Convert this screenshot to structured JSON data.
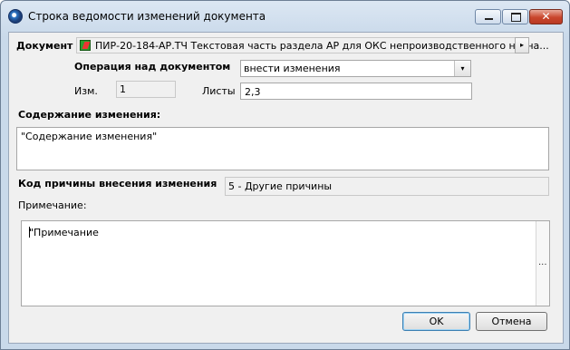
{
  "window": {
    "title": "Строка ведомости изменений документа",
    "close_glyph": "✕"
  },
  "document": {
    "label": "Документ",
    "value": "ПИР-20-184-АР.ТЧ Текстовая часть раздела АР для ОКС непроизводственного назна...",
    "icon": "document-type-icon",
    "arrow_glyph": "▸"
  },
  "operation": {
    "label": "Операция над документом",
    "value": "внести изменения",
    "dropdown_glyph": "▾"
  },
  "change_number": {
    "label": "Изм.",
    "value": "1"
  },
  "sheets": {
    "label": "Листы",
    "value": "2,3"
  },
  "content": {
    "label": "Содержание изменения:",
    "value": "\"Содержание изменения\""
  },
  "reason_code": {
    "label": "Код причины внесения изменения",
    "value": "5 - Другие причины"
  },
  "note": {
    "label": "Примечание:",
    "value_before_caret": "\"Примечание",
    "value_after_caret": "\"",
    "ellipsis": "..."
  },
  "buttons": {
    "ok": "OK",
    "cancel": "Отмена"
  }
}
